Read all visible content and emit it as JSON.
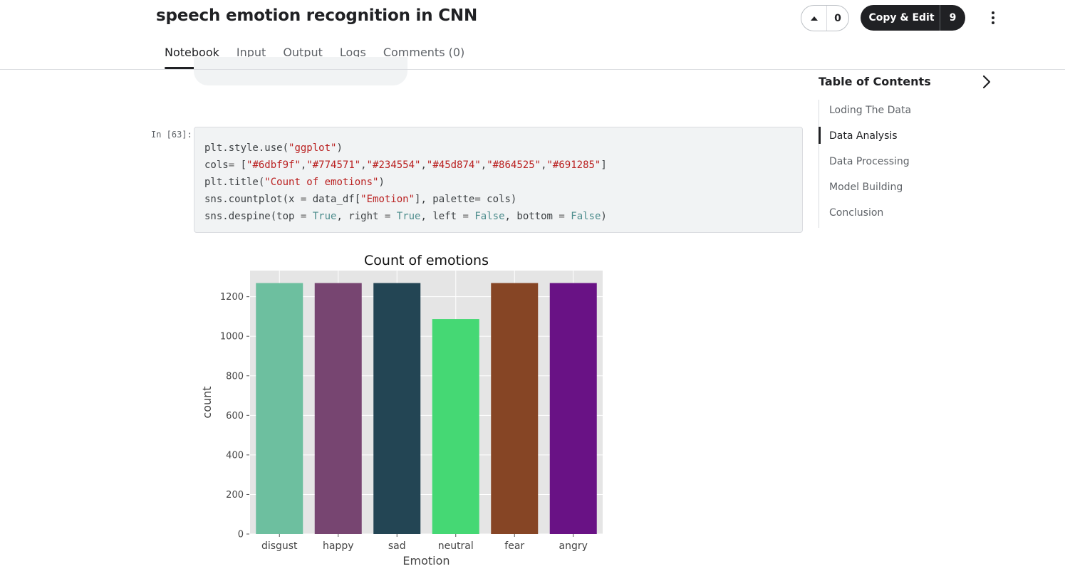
{
  "header": {
    "title": "speech emotion recognition in CNN",
    "vote_count": "0",
    "copy_edit_label": "Copy & Edit",
    "copy_edit_count": "9"
  },
  "tabs": [
    {
      "label": "Notebook",
      "active": true
    },
    {
      "label": "Input",
      "active": false
    },
    {
      "label": "Output",
      "active": false
    },
    {
      "label": "Logs",
      "active": false
    },
    {
      "label": "Comments (0)",
      "active": false
    }
  ],
  "cell": {
    "prompt": "In [63]:",
    "lines": [
      [
        [
          "plain",
          "plt.style.use("
        ],
        [
          "str",
          "\"ggplot\""
        ],
        [
          "plain",
          ")"
        ]
      ],
      [
        [
          "plain",
          "cols"
        ],
        [
          "op",
          "="
        ],
        [
          "plain",
          " ["
        ],
        [
          "str",
          "\"#6dbf9f\""
        ],
        [
          "plain",
          ","
        ],
        [
          "str",
          "\"#774571\""
        ],
        [
          "plain",
          ","
        ],
        [
          "str",
          "\"#234554\""
        ],
        [
          "plain",
          ","
        ],
        [
          "str",
          "\"#45d874\""
        ],
        [
          "plain",
          ","
        ],
        [
          "str",
          "\"#864525\""
        ],
        [
          "plain",
          ","
        ],
        [
          "str",
          "\"#691285\""
        ],
        [
          "plain",
          "]"
        ]
      ],
      [
        [
          "plain",
          "plt.title("
        ],
        [
          "str",
          "\"Count of emotions\""
        ],
        [
          "plain",
          ")"
        ]
      ],
      [
        [
          "plain",
          "sns.countplot(x "
        ],
        [
          "op",
          "="
        ],
        [
          "plain",
          " data_df["
        ],
        [
          "str",
          "\"Emotion\""
        ],
        [
          "plain",
          "], palette"
        ],
        [
          "op",
          "="
        ],
        [
          "plain",
          " cols)"
        ]
      ],
      [
        [
          "plain",
          "sns.despine(top "
        ],
        [
          "op",
          "="
        ],
        [
          "plain",
          " "
        ],
        [
          "bool",
          "True"
        ],
        [
          "plain",
          ", right "
        ],
        [
          "op",
          "="
        ],
        [
          "plain",
          " "
        ],
        [
          "bool",
          "True"
        ],
        [
          "plain",
          ", left "
        ],
        [
          "op",
          "="
        ],
        [
          "plain",
          " "
        ],
        [
          "bool",
          "False"
        ],
        [
          "plain",
          ", bottom "
        ],
        [
          "op",
          "="
        ],
        [
          "plain",
          " "
        ],
        [
          "bool",
          "False"
        ],
        [
          "plain",
          ")"
        ]
      ]
    ]
  },
  "toc": {
    "title": "Table of Contents",
    "items": [
      {
        "label": "Loding The Data",
        "active": false
      },
      {
        "label": "Data Analysis",
        "active": true
      },
      {
        "label": "Data Processing",
        "active": false
      },
      {
        "label": "Model Building",
        "active": false
      },
      {
        "label": "Conclusion",
        "active": false
      }
    ]
  },
  "chart_data": {
    "type": "bar",
    "title": "Count of emotions",
    "xlabel": "Emotion",
    "ylabel": "count",
    "categories": [
      "disgust",
      "happy",
      "sad",
      "neutral",
      "fear",
      "angry"
    ],
    "values": [
      1269,
      1269,
      1269,
      1087,
      1269,
      1269
    ],
    "colors": [
      "#6dbf9f",
      "#774571",
      "#234554",
      "#45d874",
      "#864525",
      "#691285"
    ],
    "yticks": [
      0,
      200,
      400,
      600,
      800,
      1000,
      1200
    ],
    "ylim": [
      0,
      1332
    ],
    "grid": true,
    "background": "#e5e5e5"
  }
}
